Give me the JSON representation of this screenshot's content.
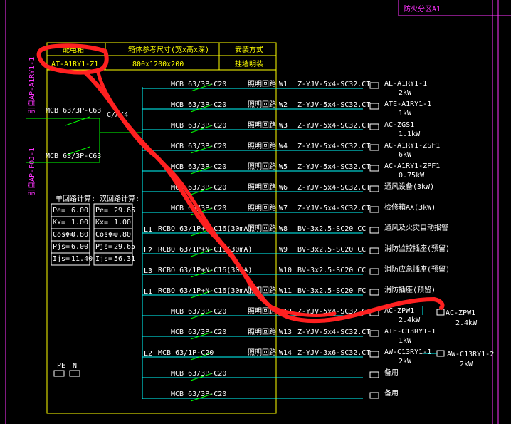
{
  "zone_label": "防火分区A1",
  "header": {
    "col1": "配电箱",
    "col2": "箱体参考尺寸(宽x高x深)",
    "col3": "安装方式",
    "box_id": "AT-A1RY1-Z1",
    "box_size": "800x1200x200",
    "install": "挂墙明装"
  },
  "incoming": [
    {
      "feeder": "引自AP-A1RY1-1",
      "breaker": "MCB 63/3P-C63"
    },
    {
      "feeder": "引自AP-F0J-1",
      "breaker": "MCB 63/3P-C63"
    }
  ],
  "ats_label": "C/A/4",
  "calc": {
    "left_title": "单回路计算:",
    "right_title": "双回路计算:",
    "rows": [
      {
        "k": "Pe=",
        "v1": "6.00",
        "v2": "29.65"
      },
      {
        "k": "Kx=",
        "v1": "1.00",
        "v2": "1.00"
      },
      {
        "k": "CosΦ=",
        "v1": "0.80",
        "v2": "0.80"
      },
      {
        "k": "Pjs=",
        "v1": "6.00",
        "v2": "29.65"
      },
      {
        "k": "Ijs=",
        "v1": "11.40",
        "v2": "56.31"
      }
    ]
  },
  "pe_n": {
    "pe": "PE",
    "n": "N"
  },
  "circuits": [
    {
      "phase": "",
      "breaker": "MCB 63/3P-C20",
      "kind": "照明回路",
      "no": "W1",
      "cable": "Z-YJV-5x4-SC32.CT",
      "load": "AL-A1RY1-1",
      "kw": "2kW"
    },
    {
      "phase": "",
      "breaker": "MCB 63/3P-C20",
      "kind": "照明回路",
      "no": "W2",
      "cable": "Z-YJV-5x4-SC32.CT",
      "load": "ATE-A1RY1-1",
      "kw": "1kW"
    },
    {
      "phase": "",
      "breaker": "MCB 63/3P-C20",
      "kind": "照明回路",
      "no": "W3",
      "cable": "Z-YJV-5x4-SC32.CT",
      "load": "AC-ZGS1",
      "kw": "1.1kW"
    },
    {
      "phase": "",
      "breaker": "MCB 63/3P-C20",
      "kind": "照明回路",
      "no": "W4",
      "cable": "Z-YJV-5x4-SC32.CT",
      "load": "AC-A1RY1-ZSF1",
      "kw": "6kW"
    },
    {
      "phase": "",
      "breaker": "MCB 63/3P-C20",
      "kind": "照明回路",
      "no": "W5",
      "cable": "Z-YJV-5x4-SC32.CT",
      "load": "AC-A1RY1-ZPF1",
      "kw": "0.75kW"
    },
    {
      "phase": "",
      "breaker": "MCB 63/3P-C20",
      "kind": "照明回路",
      "no": "W6",
      "cable": "Z-YJV-5x4-SC32.CT",
      "load": "通风设备(3kW)",
      "kw": ""
    },
    {
      "phase": "",
      "breaker": "MCB 63/3P-C20",
      "kind": "照明回路",
      "no": "W7",
      "cable": "Z-YJV-5x4-SC32.CT",
      "load": "检修箱AX(3kW)",
      "kw": ""
    },
    {
      "phase": "L1",
      "breaker": "RCBO 63/1P+N-C16(30mA)",
      "kind": "照明回路",
      "no": "W8",
      "cable": "BV-3x2.5-SC20 CC",
      "load": "通风及火灾自动报警",
      "kw": ""
    },
    {
      "phase": "L2",
      "breaker": "RCBO 63/1P+N-C16(30mA)",
      "kind": "",
      "no": "W9",
      "cable": "BV-3x2.5-SC20 CC",
      "load": "消防监控插座(预留)",
      "kw": ""
    },
    {
      "phase": "L3",
      "breaker": "RCBO 63/1P+N-C16(30mA)",
      "kind": "",
      "no": "W10",
      "cable": "BV-3x2.5-SC20 CC",
      "load": "消防应急插座(预留)",
      "kw": ""
    },
    {
      "phase": "L1",
      "breaker": "RCBO 63/1P+N-C16(30mA)",
      "kind": "照明回路",
      "no": "W11",
      "cable": "BV-3x2.5-SC20 FC",
      "load": "消防插座(预留)",
      "kw": ""
    },
    {
      "phase": "",
      "breaker": "MCB 63/3P-C20",
      "kind": "照明回路",
      "no": "W12",
      "cable": "Z-YJV-5x4-SC32.CT",
      "load": "AC-ZPW1",
      "kw": "2.4kW"
    },
    {
      "phase": "",
      "breaker": "MCB 63/3P-C20",
      "kind": "照明回路",
      "no": "W13",
      "cable": "Z-YJV-5x4-SC32.CT",
      "load": "ATE-C13RY1-1",
      "kw": "1kW"
    },
    {
      "phase": "L2",
      "breaker": "MCB 63/1P-C20",
      "kind": "照明回路",
      "no": "W14",
      "cable": "Z-YJV-3x6-SC32.CT",
      "load": "AW-C13RY1-1",
      "kw": "2kW"
    },
    {
      "phase": "",
      "breaker": "MCB 63/3P-C20",
      "kind": "",
      "no": "",
      "cable": "",
      "load": "备用",
      "kw": ""
    },
    {
      "phase": "",
      "breaker": "MCB 63/3P-C20",
      "kind": "",
      "no": "",
      "cable": "",
      "load": "备用",
      "kw": ""
    }
  ],
  "extra_loads": [
    {
      "load": "AC-ZPW1",
      "kw": "2.4kW"
    },
    {
      "load": "AW-C13RY1-2",
      "kw": "2kW"
    }
  ],
  "colors": {
    "frame": "#ffff00",
    "text": "#ffffff",
    "wire": "#00ffff",
    "switch": "#00ff00",
    "feeder": "#ff33ff",
    "markup": "#ff2020"
  }
}
